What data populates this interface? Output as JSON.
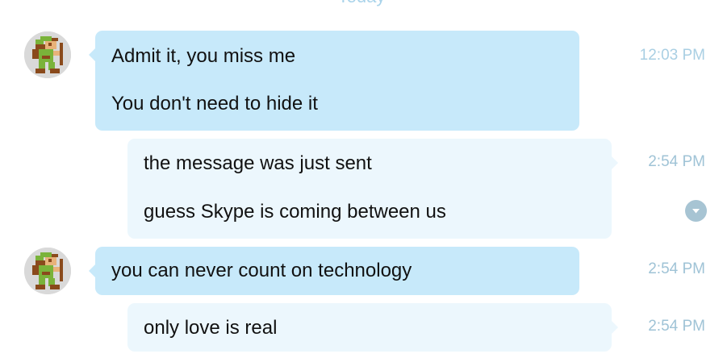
{
  "day_separator": "Today",
  "messages": [
    {
      "sender": "contact",
      "lines": [
        "Admit it, you miss me",
        "You don't need to hide it"
      ],
      "time": "12:03 PM"
    },
    {
      "sender": "me",
      "lines": [
        "the message was just sent",
        "guess Skype is coming between us"
      ],
      "time": "2:54 PM"
    },
    {
      "sender": "contact",
      "lines": [
        "you can never count on technology"
      ],
      "time": "2:54 PM"
    },
    {
      "sender": "me",
      "lines": [
        "only love is real"
      ],
      "time": "2:54 PM"
    }
  ],
  "icons": {
    "avatar": "pixel-character-avatar",
    "options": "chevron-down-icon"
  },
  "colors": {
    "incoming_bubble": "#c7e9fa",
    "outgoing_bubble": "#ecf7fd",
    "timestamp": "#a9cfe3",
    "day_separator": "#a9d3ea",
    "message_text": "#111111"
  }
}
